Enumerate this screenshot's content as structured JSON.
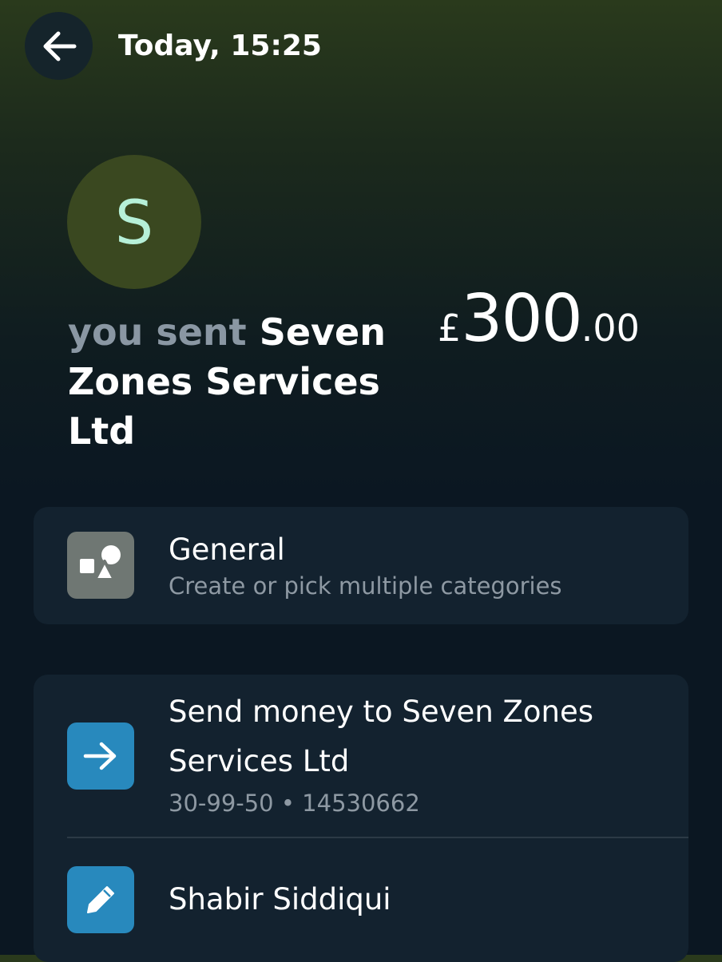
{
  "header": {
    "back_icon": "arrow-left-icon",
    "time": "Today, 15:25"
  },
  "payee": {
    "avatar_initial": "S",
    "prefix": "you sent",
    "name": "Seven Zones Services Ltd"
  },
  "amount": {
    "currency": "£",
    "whole": "300",
    "fraction": ".00"
  },
  "category": {
    "icon": "shapes-icon",
    "title": "General",
    "subtitle": "Create or pick multiple categories"
  },
  "send_again": {
    "icon": "arrow-right-icon",
    "title": "Send money to Seven Zones Services Ltd",
    "details": "30-99-50 • 14530662"
  },
  "note": {
    "icon": "pencil-icon",
    "text": "Shabir Siddiqui"
  },
  "colors": {
    "accent_blue": "#2889bd",
    "avatar_bg": "#3a4820",
    "avatar_text": "#b6f0d8",
    "card_bg": "#13222f"
  }
}
